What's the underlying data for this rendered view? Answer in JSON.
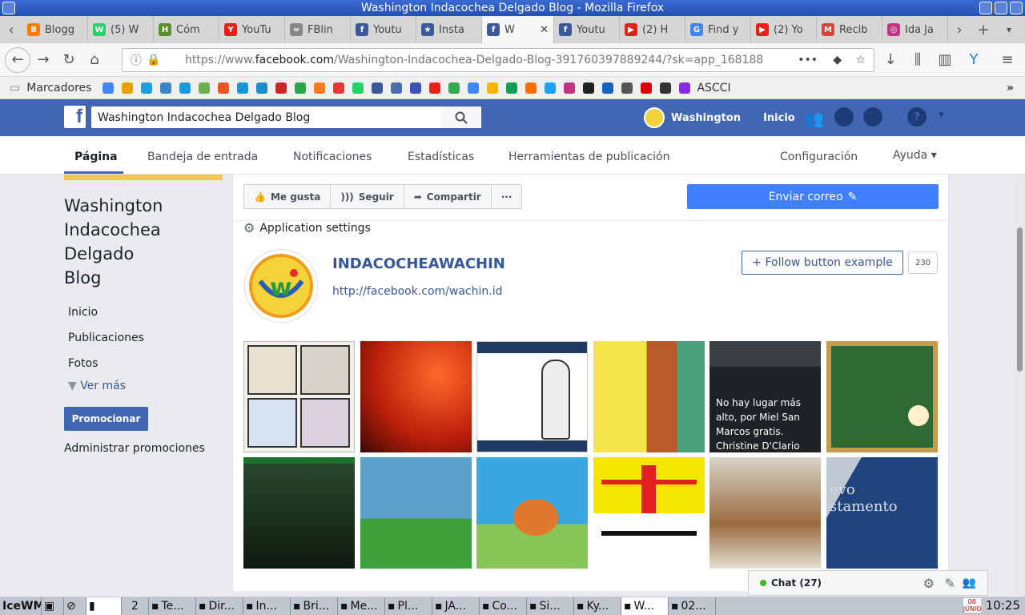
{
  "window": {
    "title": "Washington Indacochea Delgado Blog - Mozilla Firefox"
  },
  "tabs": [
    {
      "label": "Blogg",
      "color": "#f57d00",
      "glyph": "B"
    },
    {
      "label": "(5) W",
      "color": "#25d366",
      "glyph": "W"
    },
    {
      "label": "Cóm",
      "color": "#5a8f2e",
      "glyph": "H"
    },
    {
      "label": "YouTu",
      "color": "#e62117",
      "glyph": "Y"
    },
    {
      "label": "FBlin",
      "color": "#888888",
      "glyph": "∞"
    },
    {
      "label": "Youtu",
      "color": "#3b5998",
      "glyph": "f"
    },
    {
      "label": "Insta",
      "color": "#3b5998",
      "glyph": "★"
    },
    {
      "label": "W",
      "color": "#3b5998",
      "glyph": "f"
    },
    {
      "label": "Youtu",
      "color": "#3b5998",
      "glyph": "f"
    },
    {
      "label": "(2) H",
      "color": "#e62117",
      "glyph": "▶"
    },
    {
      "label": "Find y",
      "color": "#4285f4",
      "glyph": "G"
    },
    {
      "label": "(2) Yo",
      "color": "#e62117",
      "glyph": "▶"
    },
    {
      "label": "Recib",
      "color": "#d44638",
      "glyph": "M"
    },
    {
      "label": "Ida Ja",
      "color": "#c13584",
      "glyph": "◎"
    }
  ],
  "address": {
    "prefix": "https://www.",
    "domain": "facebook.com",
    "path": "/Washington-Indacochea-Delgado-Blog-391760397889244/?sk=app_168188"
  },
  "bookmarks": {
    "label": "Marcadores",
    "ascci": "ASCCI"
  },
  "fb": {
    "search_value": "Washington Indacochea Delgado Blog",
    "user": "Washington",
    "home": "Inicio"
  },
  "pagenav": {
    "pagina": "Página",
    "inbox": "Bandeja de entrada",
    "notifications": "Notificaciones",
    "stats": "Estadísticas",
    "tools": "Herramientas de publicación",
    "settings": "Configuración",
    "help": "Ayuda ▾"
  },
  "sidebar": {
    "page_name": "Washington Indacochea Delgado Blog",
    "items": [
      "Inicio",
      "Publicaciones",
      "Fotos"
    ],
    "more": "Ver más",
    "promote": "Promocionar",
    "manage": "Administrar promociones"
  },
  "actions": {
    "like": "Me gusta",
    "follow": "Seguir",
    "share": "Compartir",
    "more": "···",
    "send": "Enviar correo"
  },
  "app": {
    "settings": "Application settings",
    "name": "INDACOCHEAWACHIN",
    "link": "http://facebook.com/wachin.id",
    "follow_btn": "+ Follow button example",
    "count": "230",
    "video_caption": "No hay lugar más alto, por Miel San Marcos gratis. Christine D'Clario Interpretado"
  },
  "chat": {
    "label": "Chat (27)"
  },
  "taskbar": {
    "wm": "IceWM",
    "desk": "2",
    "items": [
      "Te...",
      "Dir...",
      "In...",
      "Bri...",
      "Me...",
      "Pl...",
      "JA...",
      "Co...",
      "Si...",
      "Ky...",
      "W...",
      "02..."
    ],
    "clock": "10:25",
    "date": "08 JUNIO"
  }
}
